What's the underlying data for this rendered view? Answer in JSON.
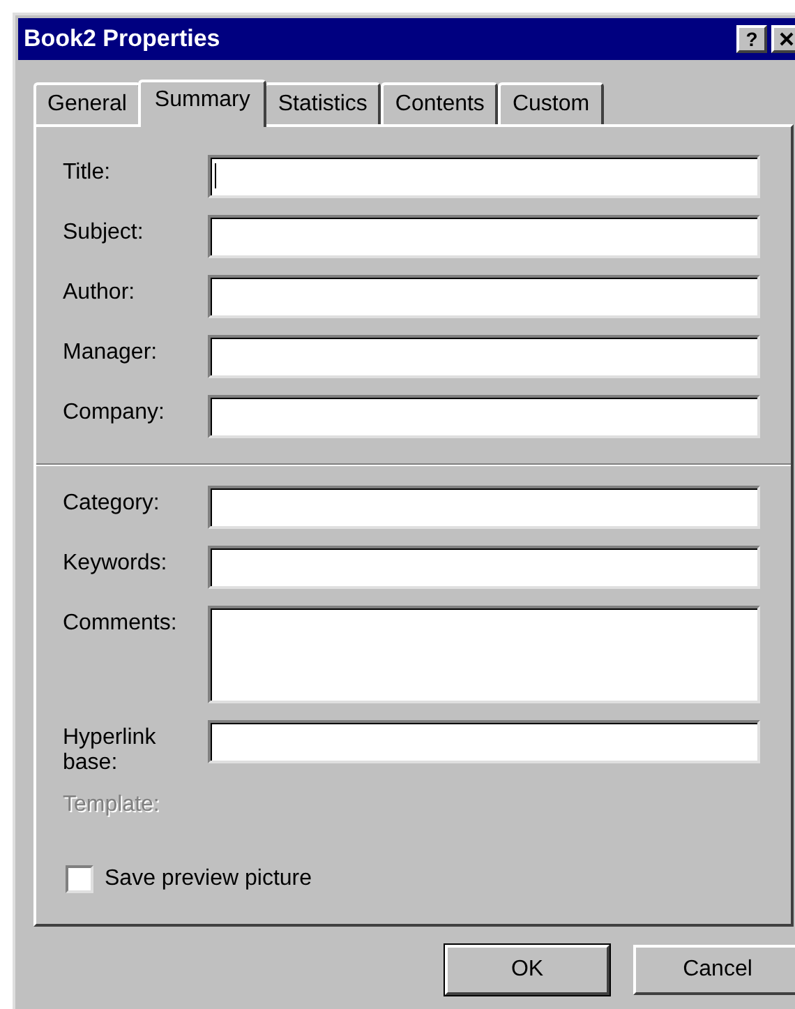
{
  "window": {
    "title": "Book2 Properties",
    "help_button": {
      "label": "?"
    }
  },
  "tabs": [
    {
      "label": "General",
      "selected": false
    },
    {
      "label": "Summary",
      "selected": true
    },
    {
      "label": "Statistics",
      "selected": false
    },
    {
      "label": "Contents",
      "selected": false
    },
    {
      "label": "Custom",
      "selected": false
    }
  ],
  "fields": [
    {
      "kind": "text",
      "label": "Title:",
      "focused": true
    },
    {
      "kind": "text",
      "label": "Subject:",
      "focused": false
    },
    {
      "kind": "text",
      "label": "Author:",
      "focused": false
    },
    {
      "kind": "text",
      "label": "Manager:",
      "focused": false
    },
    {
      "kind": "text",
      "label": "Company:",
      "focused": false
    },
    {
      "kind": "separator"
    },
    {
      "kind": "text",
      "label": "Category:",
      "focused": false
    },
    {
      "kind": "text",
      "label": "Keywords:",
      "focused": false
    },
    {
      "kind": "multiline",
      "label": "Comments:",
      "focused": false
    },
    {
      "kind": "text",
      "label": "Hyperlink base:",
      "focused": false
    },
    {
      "kind": "static",
      "label": "Template:",
      "disabled": true
    }
  ],
  "checkbox": {
    "label": "Save preview picture",
    "checked": false
  },
  "buttons": [
    {
      "label": "OK",
      "default": true
    },
    {
      "label": "Cancel",
      "default": false
    }
  ]
}
